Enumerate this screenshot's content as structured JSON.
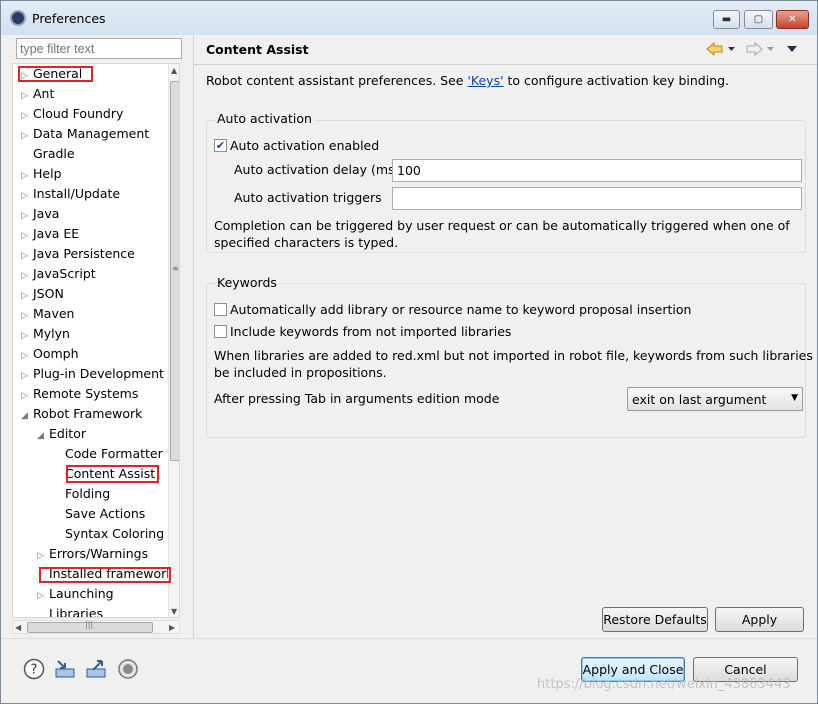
{
  "window": {
    "title": "Preferences"
  },
  "filter": {
    "placeholder": "type filter text"
  },
  "tree": {
    "items": [
      {
        "label": "General",
        "arrow": "▷"
      },
      {
        "label": "Ant",
        "arrow": "▷"
      },
      {
        "label": "Cloud Foundry",
        "arrow": "▷"
      },
      {
        "label": "Data Management",
        "arrow": "▷"
      },
      {
        "label": "Gradle",
        "arrow": ""
      },
      {
        "label": "Help",
        "arrow": "▷"
      },
      {
        "label": "Install/Update",
        "arrow": "▷"
      },
      {
        "label": "Java",
        "arrow": "▷"
      },
      {
        "label": "Java EE",
        "arrow": "▷"
      },
      {
        "label": "Java Persistence",
        "arrow": "▷"
      },
      {
        "label": "JavaScript",
        "arrow": "▷"
      },
      {
        "label": "JSON",
        "arrow": "▷"
      },
      {
        "label": "Maven",
        "arrow": "▷"
      },
      {
        "label": "Mylyn",
        "arrow": "▷"
      },
      {
        "label": "Oomph",
        "arrow": "▷"
      },
      {
        "label": "Plug-in Development",
        "arrow": "▷"
      },
      {
        "label": "Remote Systems",
        "arrow": "▷"
      },
      {
        "label": "Robot Framework",
        "arrow": "◢"
      },
      {
        "label": "Editor",
        "arrow": "◢"
      },
      {
        "label": "Code Formatter",
        "arrow": ""
      },
      {
        "label": "Content Assist",
        "arrow": ""
      },
      {
        "label": "Folding",
        "arrow": ""
      },
      {
        "label": "Save Actions",
        "arrow": ""
      },
      {
        "label": "Syntax Coloring",
        "arrow": ""
      },
      {
        "label": "Errors/Warnings",
        "arrow": "▷"
      },
      {
        "label": "Installed framework",
        "arrow": ""
      },
      {
        "label": "Launching",
        "arrow": "▷"
      },
      {
        "label": "Libraries",
        "arrow": ""
      }
    ]
  },
  "page": {
    "title": "Content Assist",
    "desc_before": "Robot content assistant preferences. See ",
    "desc_link": "'Keys'",
    "desc_after": " to configure activation key binding.",
    "auto": {
      "group_label": "Auto activation",
      "enabled_label": "Auto activation enabled",
      "enabled": true,
      "delay_label": "Auto activation delay (ms)",
      "delay_value": "100",
      "triggers_label": "Auto activation triggers",
      "triggers_value": "",
      "note_line1": "Completion can be triggered by user request or can be automatically triggered when one of",
      "note_line2": "specified characters is typed."
    },
    "keywords": {
      "group_label": "Keywords",
      "add_label": "Automatically add library or resource name to keyword proposal insertion",
      "add_checked": false,
      "include_label": "Include keywords from not imported libraries",
      "include_checked": false,
      "note_line1": "When libraries are added to red.xml but not imported in robot file, keywords from such libraries will",
      "note_line2": "be included in propositions.",
      "tab_label": "After pressing Tab in arguments edition mode",
      "tab_value": "exit on last argument"
    },
    "restore_label": "Restore Defaults",
    "apply_label": "Apply"
  },
  "footer": {
    "apply_close_label": "Apply and Close",
    "cancel_label": "Cancel"
  },
  "watermark": "https://blog.csdn.net/weixin_43863443"
}
